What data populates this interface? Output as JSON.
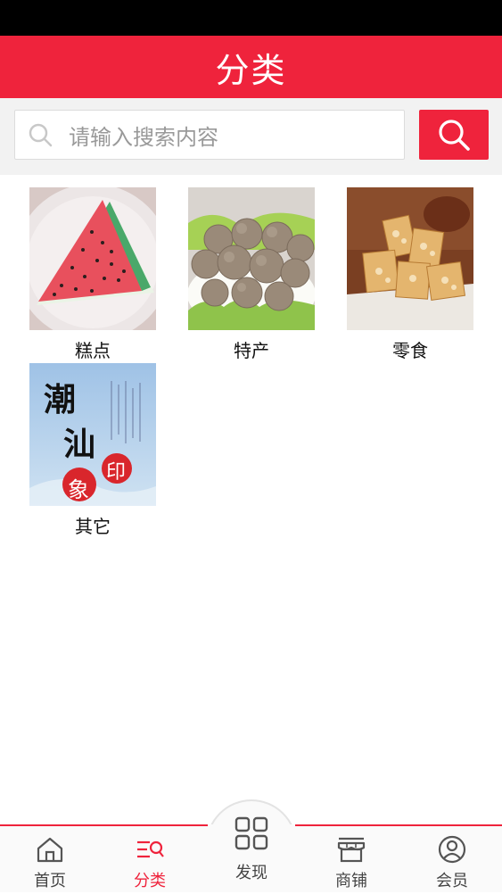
{
  "header": {
    "title": "分类"
  },
  "search": {
    "placeholder": "请输入搜索内容"
  },
  "categories": [
    {
      "label": "糕点",
      "image": "watermelon-cake"
    },
    {
      "label": "特产",
      "image": "beef-balls"
    },
    {
      "label": "零食",
      "image": "peanut-candy"
    },
    {
      "label": "其它",
      "image": "chaoshan-poster"
    }
  ],
  "poster": {
    "line1": "潮",
    "line2": "汕",
    "seal1": "印",
    "seal2": "象"
  },
  "tabs": [
    {
      "label": "首页",
      "icon": "home-icon",
      "active": false
    },
    {
      "label": "分类",
      "icon": "category-icon",
      "active": true
    },
    {
      "label": "发现",
      "icon": "grid-icon",
      "active": false
    },
    {
      "label": "商铺",
      "icon": "store-icon",
      "active": false
    },
    {
      "label": "会员",
      "icon": "user-icon",
      "active": false
    }
  ],
  "colors": {
    "accent": "#ef233c",
    "background": "#ffffff"
  }
}
